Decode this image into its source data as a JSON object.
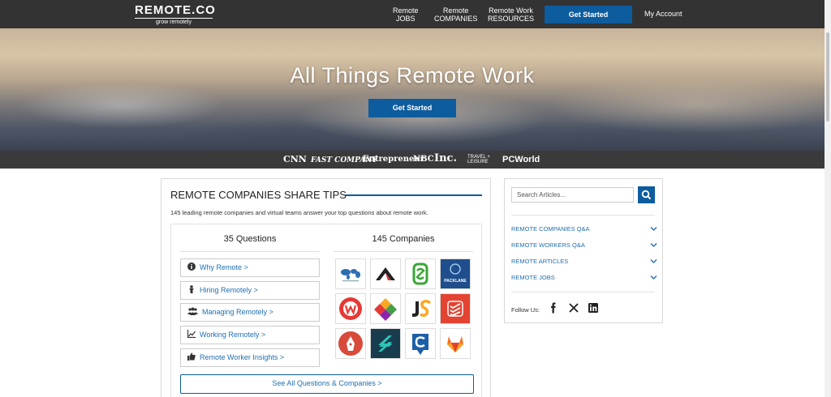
{
  "header": {
    "logo_name": "REMOTE.CO",
    "logo_tagline": "grow remotely",
    "nav": [
      {
        "line1": "Remote",
        "line2": "JOBS"
      },
      {
        "line1": "Remote",
        "line2": "COMPANIES"
      },
      {
        "line1": "Remote Work",
        "line2": "RESOURCES"
      }
    ],
    "cta": "Get Started",
    "account": "My Account"
  },
  "hero": {
    "title": "All Things Remote Work",
    "cta": "Get Started"
  },
  "press": {
    "logos": [
      "CNN",
      "FAST COMPANY",
      "Entrepreneur",
      "NBC",
      "Inc.",
      "TRAVEL + LEISURE",
      "PCWorld"
    ]
  },
  "main": {
    "title": "REMOTE COMPANIES SHARE TIPS",
    "subtitle": "145 leading remote companies and virtual teams answer your top questions about remote work.",
    "questions_heading": "35 Questions",
    "companies_heading": "145 Companies",
    "questions": [
      {
        "label": "Why Remote >",
        "icon": "info-icon"
      },
      {
        "label": "Hiring Remotely >",
        "icon": "person-icon"
      },
      {
        "label": "Managing Remotely >",
        "icon": "group-icon"
      },
      {
        "label": "Working Remotely >",
        "icon": "chart-icon"
      },
      {
        "label": "Remote Worker Insights >",
        "icon": "thumbs-up-icon"
      }
    ],
    "company_logos": [
      "world-map-logo",
      "red-roof-logo",
      "green-s-logo",
      "packlane-logo",
      "red-w-logo",
      "colorful-diamond-logo",
      "js-logo",
      "red-todoist-logo",
      "red-pen-logo",
      "teal-bolt-logo",
      "blue-c-logo",
      "gitlab-fox-logo"
    ],
    "packlane_text": "PACKLANE",
    "see_all": "See All Questions & Companies >"
  },
  "sidebar": {
    "search_placeholder": "Search Articles...",
    "items": [
      "REMOTE COMPANIES Q&A",
      "REMOTE WORKERS Q&A",
      "REMOTE ARTICLES",
      "REMOTE JOBS"
    ],
    "follow_label": "Follow Us:",
    "social": [
      "facebook-icon",
      "x-icon",
      "linkedin-icon"
    ]
  },
  "colors": {
    "header_bg": "#333333",
    "accent_blue": "#0d5c9e",
    "link_blue": "#1f6fb0",
    "press_bg": "#3a3a3a"
  }
}
